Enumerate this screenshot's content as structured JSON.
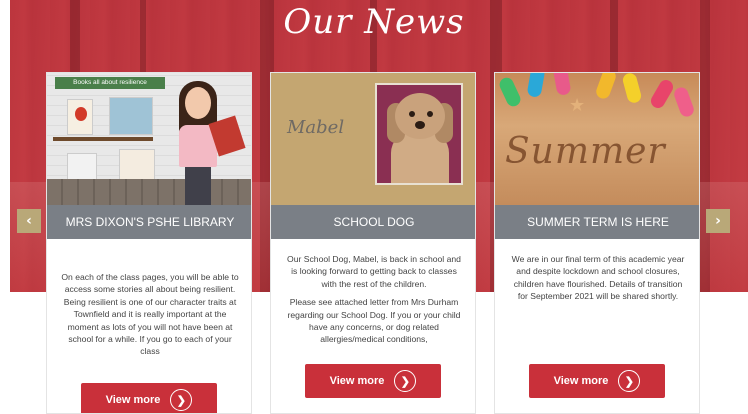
{
  "section": {
    "title": "Our News"
  },
  "nav": {
    "prev_icon": "chevron-left-icon",
    "next_icon": "chevron-right-icon",
    "prev_glyph": "‹",
    "next_glyph": "›"
  },
  "cards": [
    {
      "image_label": "Books all about resilience",
      "title": "MRS DIXON'S PSHE LIBRARY",
      "paragraphs": [
        "On each of the class pages, you will be able to access some stories all about being resilient.  Being resilient is one of our character traits at Townfield and it is really important at the moment as lots of you will not have been at school for a while.  If you go to each of your class"
      ],
      "button_label": "View more"
    },
    {
      "image_label": "Mabel",
      "title": "SCHOOL DOG",
      "paragraphs": [
        "Our School Dog, Mabel, is back in school and is looking forward to getting back to classes with the rest of the children.",
        "Please see attached letter from Mrs Durham regarding our School Dog.  If you or your child have any concerns, or dog related allergies/medical conditions,"
      ],
      "button_label": "View more"
    },
    {
      "image_label": "Summer",
      "title": "SUMMER TERM IS HERE",
      "paragraphs": [
        "We are in our final term of this academic year and despite lockdown and school closures, children have flourished.  Details of transition for September 2021 will be shared shortly."
      ],
      "button_label": "View more"
    }
  ],
  "colors": {
    "accent": "#c9303a",
    "header_gray": "#7a7f86",
    "arrow": "#b9a878"
  }
}
